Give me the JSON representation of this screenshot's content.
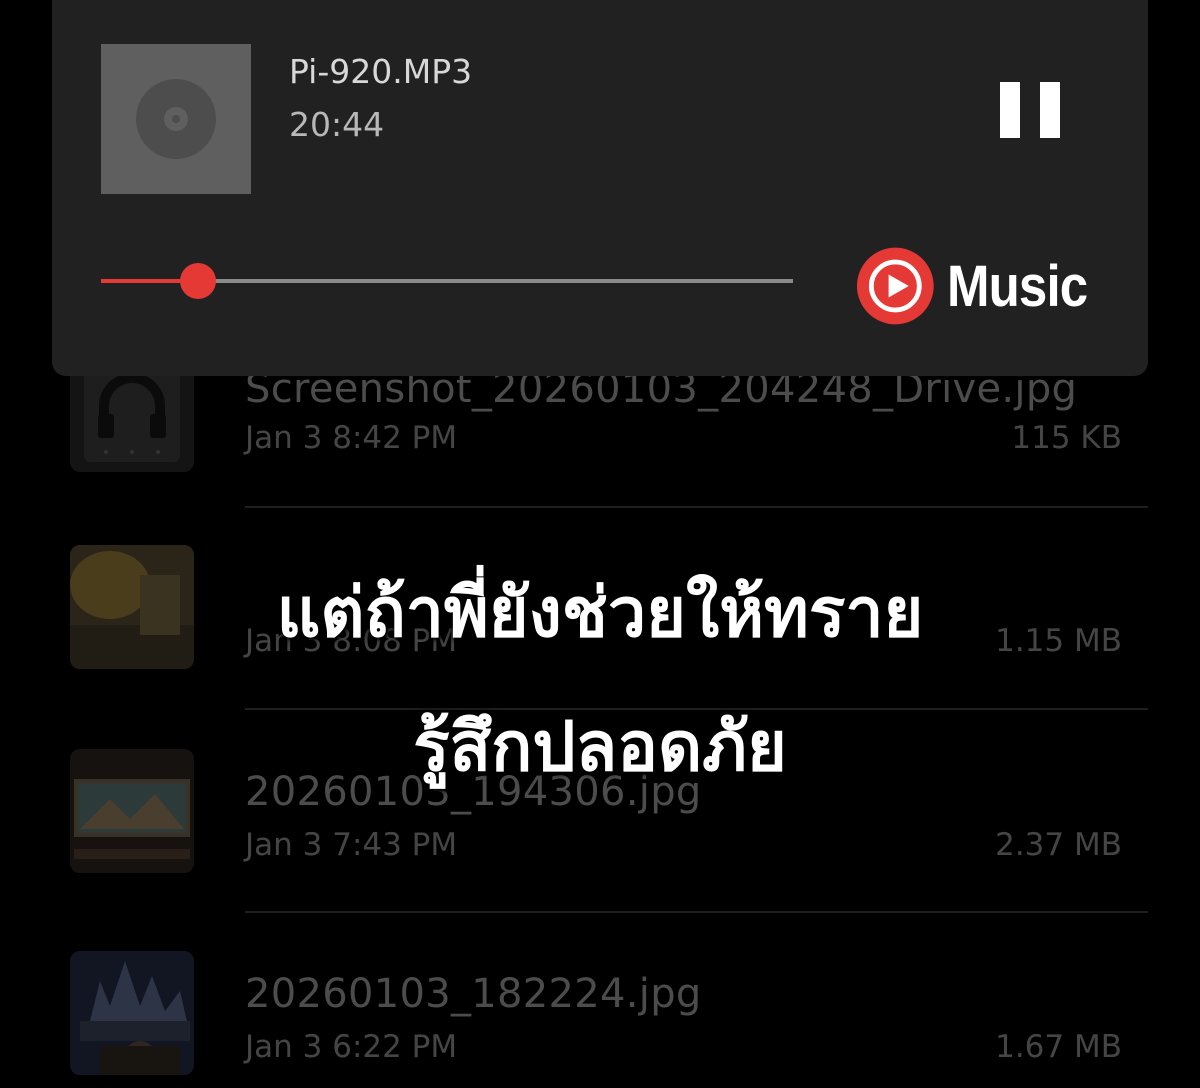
{
  "player": {
    "title": "Pi-920.MP3",
    "elapsed": "20:44",
    "progress": 0.14,
    "logo_text": "Music",
    "accent_color": "#e53935",
    "state": "playing"
  },
  "files": [
    {
      "name": "Screenshot_20260103_204248_Drive.jpg",
      "date": "Jan 3 8:42 PM",
      "size": "115 KB",
      "thumb": "headphones-screenshot"
    },
    {
      "name": "",
      "date": "Jan 3 8:08 PM",
      "size": "1.15 MB",
      "thumb": "photo-yellow"
    },
    {
      "name": "20260103_194306.jpg",
      "date": "Jan 3 7:43 PM",
      "size": "2.37 MB",
      "thumb": "photo-painting"
    },
    {
      "name": "20260103_182224.jpg",
      "date": "Jan 3 6:22 PM",
      "size": "1.67 MB",
      "thumb": "photo-castle-night"
    }
  ],
  "caption": {
    "line1": "แต่ถ้าพี่ยังช่วยให้ทราย",
    "line2": "รู้สึกปลอดภัย"
  }
}
